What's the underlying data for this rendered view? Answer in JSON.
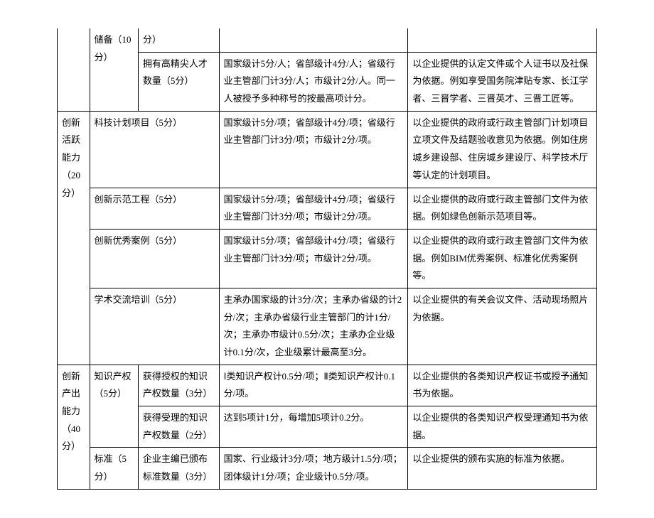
{
  "rows": {
    "r1": {
      "c2": "储备（10分）",
      "c3": "分）"
    },
    "r2": {
      "c3": "拥有高精尖人才数量（5分）",
      "c4": "国家级计5分/人；省部级计4分/人；省级行业主管部门计3分/人；市级计2分/人。同一人被授予多种称号的按最高项计分。",
      "c5": "以企业提供的认定文件或个人证书以及社保为依据。例如享受国务院津贴专家、长江学者、三晋学者、三晋英才、三晋工匠等。"
    },
    "r3": {
      "c1": "创新活跃能力（20分）",
      "c2": "科技计划项目（5分）",
      "c4": "国家级计5分/项；省部级计4分/项；省级行业主管部门计3分/项；市级计2分/项。",
      "c5": "以企业提供的政府或行政主管部门计划项目立项文件及结题验收意见为依据。例如住房城乡建设部、住房城乡建设厅、科学技术厅等认定的计划项目。"
    },
    "r4": {
      "c2": "创新示范工程（5分）",
      "c4": "国家级计5分/项；省部级计4分/项；省级行业主管部门计3分/项；市级计2分/项。",
      "c5": "以企业提供的政府或行政主管部门文件为依据。例如绿色创新示范项目等。"
    },
    "r5": {
      "c2": "创新优秀案例（5分）",
      "c4": "国家级计5分/项；省部级计4分/项；省级行业主管部门计3分/项；市级计2分/项。",
      "c5": "以企业提供的政府或行政主管部门文件为依据。例如BIM优秀案例、标准化优秀案例等。"
    },
    "r6": {
      "c2": "学术交流培训（5分）",
      "c4": "主承办国家级的计3分/次；主承办省级的计2分/次；主承办省级行业主管部门的计1分/次；主承办市级计0.5分/次；主承办企业级计0.1分/次，企业级累计最高至3分。",
      "c5": "以企业提供的有关会议文件、活动现场照片为依据。"
    },
    "r7": {
      "c1": "创新产出能力（40分）",
      "c2": "知识产权（5分）",
      "c3": "获得授权的知识产权数量（3分）",
      "c4": "Ⅰ类知识产权计0.5分/项；Ⅱ类知识产权计0.1分/项。",
      "c5": "以企业提供的各类知识产权证书或授予通知书为依据。"
    },
    "r8": {
      "c3": "获得受理的知识产权数量（2分）",
      "c4": "达到5项计1分，每增加5项计0.2分。",
      "c5": "以企业提供的各类知识产权受理通知书为依据。"
    },
    "r9": {
      "c2": "标准（5分）",
      "c3": "企业主编已颁布标准数量（3分）",
      "c4": "国家、行业级计3分/项；地方级计1.5分/项；团体级计1分/项；企业级计0.5分/项。",
      "c5": "以企业提供的颁布实施的标准为依据。"
    }
  }
}
